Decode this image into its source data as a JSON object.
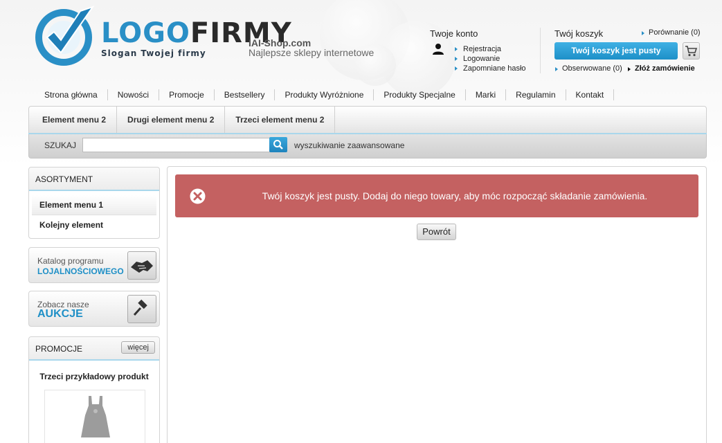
{
  "header": {
    "logo_part1": "LOGO",
    "logo_part2": "FIRMY",
    "slogan": "Slogan Twojej firmy",
    "shop_name": "IAI-Shop.com",
    "shop_desc": "Najlepsze sklepy internetowe"
  },
  "account": {
    "title": "Twoje konto",
    "links": [
      "Rejestracja",
      "Logowanie",
      "Zapomniane hasło"
    ]
  },
  "cart": {
    "title": "Twój koszyk",
    "compare": "Porównanie (0)",
    "button_label": "Twój koszyk jest pusty",
    "observed": "Obserwowane (0)",
    "place_order": "Złóż zamówienie"
  },
  "main_menu": [
    "Strona główna",
    "Nowości",
    "Promocje",
    "Bestsellery",
    "Produkty Wyróżnione",
    "Produkty Specjalne",
    "Marki",
    "Regulamin",
    "Kontakt"
  ],
  "sub_menu": [
    "Element menu 2",
    "Drugi element menu 2",
    "Trzeci element menu 2"
  ],
  "search": {
    "label": "SZUKAJ",
    "value": "",
    "advanced": "wyszukiwanie zaawansowane"
  },
  "sidebar": {
    "assortment_title": "ASORTYMENT",
    "assortment_items": [
      "Element menu 1",
      "Kolejny element"
    ],
    "loyalty_line1": "Katalog programu",
    "loyalty_line2": "LOJALNOŚCIOWEGO",
    "auction_line1": "Zobacz nasze",
    "auction_line2": "AUKCJE",
    "promotions_title": "PROMOCJE",
    "more_label": "więcej",
    "product_name": "Trzeci przykładowy produkt"
  },
  "content": {
    "alert_text": "Twój koszyk jest pusty. Dodaj do niego towary, aby móc rozpocząć składanie zamówienia.",
    "back_label": "Powrót"
  },
  "colors": {
    "brand_blue": "#2a8fc6",
    "alert_red": "#c46161"
  }
}
